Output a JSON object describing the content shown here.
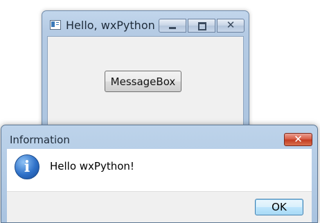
{
  "main_window": {
    "title": "Hello, wxPython",
    "icon": "app-window-icon",
    "controls": {
      "minimize_icon": "minimize-icon",
      "maximize_icon": "maximize-icon",
      "close_glyph": "✕"
    },
    "button_label": "MessageBox"
  },
  "dialog": {
    "title": "Information",
    "close_glyph": "✕",
    "icon": "info-icon",
    "icon_glyph": "i",
    "message": "Hello wxPython!",
    "ok_label": "OK"
  },
  "colors": {
    "window_frame": "#b5cbe4",
    "client_bg": "#f0f0f0",
    "close_red": "#c94b2e",
    "default_button_blue": "#3c7fb1"
  }
}
